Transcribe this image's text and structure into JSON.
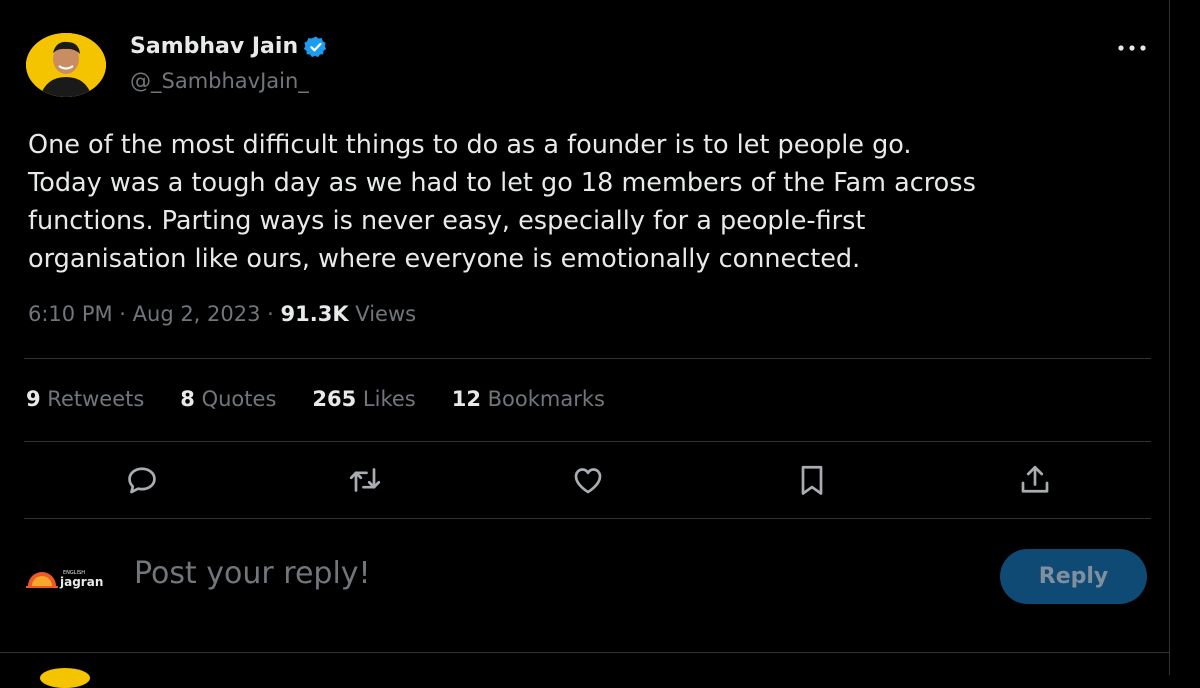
{
  "author": {
    "name": "Sambhav Jain",
    "handle": "@_SambhavJain_",
    "verified": true
  },
  "tweet": {
    "lines": [
      "One of the most difficult things to do as a founder is to let people go.",
      "Today was a tough day as we had to let go 18 members of the Fam across",
      "functions. Parting ways is never easy, especially for a people-first",
      "organisation like ours, where everyone is emotionally connected."
    ],
    "time": "6:10 PM · Aug 2, 2023 · ",
    "views_count": "91.3K",
    "views_label": " Views"
  },
  "stats": [
    {
      "count": "9",
      "label": " Retweets"
    },
    {
      "count": "8",
      "label": " Quotes"
    },
    {
      "count": "265",
      "label": " Likes"
    },
    {
      "count": "12",
      "label": " Bookmarks"
    }
  ],
  "actions": [
    "reply-icon",
    "retweet-icon",
    "like-icon",
    "bookmark-icon",
    "share-icon"
  ],
  "reply_box": {
    "logo_text_top": "ENGLISH",
    "logo_text": "jagran",
    "placeholder": "Post your reply!",
    "button_label": "Reply"
  },
  "colors": {
    "background": "#000000",
    "text": "#e7e9ea",
    "muted": "#71767b",
    "verified": "#1d9bf0",
    "reply_button": "#0e4a74"
  }
}
